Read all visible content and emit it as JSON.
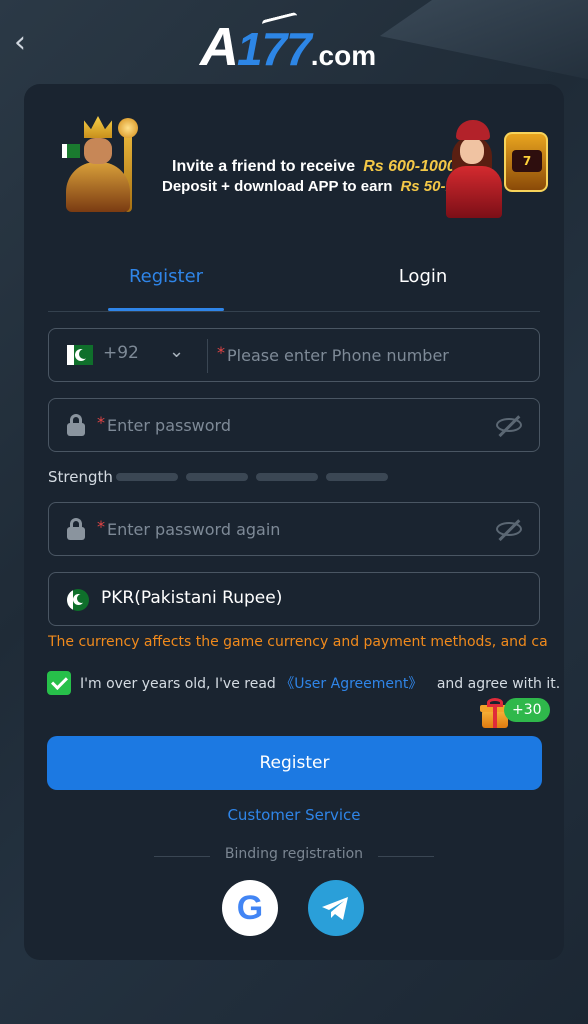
{
  "header": {
    "back_icon": "chevron-left-icon",
    "logo": {
      "a": "A",
      "number": "177",
      "domain": ".com"
    }
  },
  "banner": {
    "line1_text": "Invite a friend to receive",
    "line1_amount": "Rs 600-10000",
    "line2_text": "Deposit + download APP to earn",
    "line2_amount": "Rs 50-1000",
    "slot_label": "7"
  },
  "tabs": [
    {
      "label": "Register",
      "active": true
    },
    {
      "label": "Login",
      "active": false
    }
  ],
  "form": {
    "phone": {
      "country_code": "+92",
      "required_mark": "*",
      "placeholder": "Please enter Phone number",
      "value": ""
    },
    "password": {
      "required_mark": "*",
      "placeholder": "Enter password",
      "value": ""
    },
    "strength_label": "Strength",
    "strength_level": 0,
    "password_again": {
      "required_mark": "*",
      "placeholder": "Enter password again",
      "value": ""
    },
    "currency": {
      "value": "PKR(Pakistani Rupee)"
    },
    "currency_warning": "The currency affects the game currency and payment methods, and cannot",
    "agreement": {
      "checked": true,
      "text_before": "I'm over years old, I've read",
      "link": "《User Agreement》",
      "text_after": "and agree with it."
    },
    "bonus_badge": "+30",
    "register_button": "Register"
  },
  "footer": {
    "customer_service": "Customer Service",
    "binding_label": "Binding registration",
    "social": [
      {
        "name": "google",
        "icon": "google-icon",
        "letter": "G"
      },
      {
        "name": "telegram",
        "icon": "telegram-icon"
      }
    ]
  },
  "colors": {
    "accent": "#1c79e2",
    "background": "#1e2a36",
    "card": "#1a2430",
    "warning": "#f08a1c",
    "success": "#27c04a"
  }
}
